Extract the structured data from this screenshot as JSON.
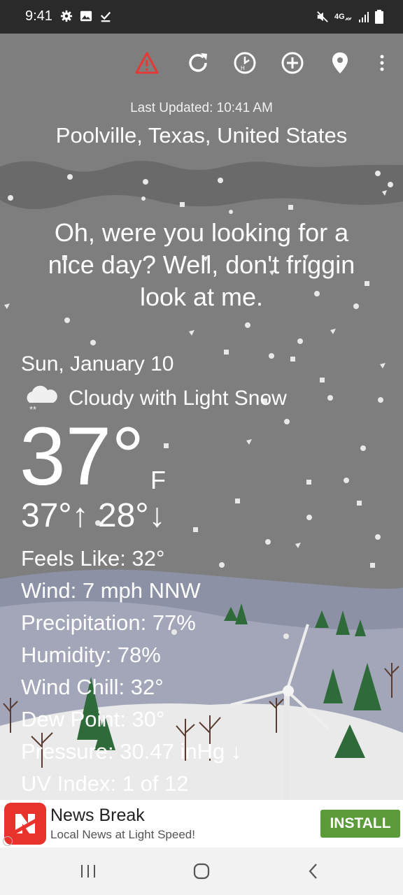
{
  "status_bar": {
    "time": "9:41",
    "left_icons": [
      "gear-icon",
      "image-icon",
      "download-done-icon"
    ],
    "right_icons": [
      "mute-icon",
      "4g-icon",
      "signal-icon",
      "battery-icon"
    ]
  },
  "toolbar": {
    "icons": [
      "alert-icon",
      "refresh-icon",
      "history-icon",
      "add-location-icon",
      "location-pin-icon",
      "more-icon"
    ],
    "alert_color": "#e53935"
  },
  "header": {
    "last_updated": "Last Updated: 10:41 AM",
    "location": "Poolville, Texas, United States"
  },
  "snark": "Oh, were you looking for a nice day? Well, don't friggin look at me.",
  "current": {
    "date": "Sun, January 10",
    "condition_icon": "cloud-snow-icon",
    "condition": "Cloudy with Light Snow",
    "temperature": "37°",
    "unit": "F",
    "hi_lo": "37°↑ 28°↓"
  },
  "details": [
    "Feels Like: 32°",
    "Wind: 7 mph NNW",
    "Precipitation: 77%",
    "Humidity: 78%",
    "Wind Chill: 32°",
    "Dew Point: 30°",
    "Pressure: 30.47 inHg ↓",
    "UV Index: 1 of 12"
  ],
  "ad": {
    "title": "News Break",
    "subtitle": "Local News at Light Speed!",
    "install_label": "INSTALL",
    "install_color": "#5b9b3a",
    "logo_color": "#e8322c"
  },
  "nav_bar": {
    "icons": [
      "recents-icon",
      "home-icon",
      "back-icon"
    ]
  }
}
